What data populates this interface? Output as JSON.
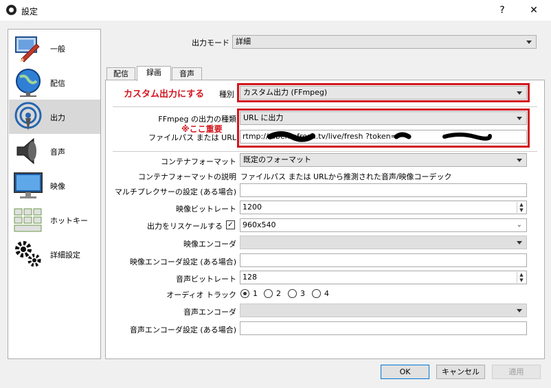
{
  "window": {
    "title": "設定",
    "help_glyph": "?",
    "close_glyph": "✕"
  },
  "sidebar": {
    "items": [
      {
        "label": "一般",
        "icon": "general-icon"
      },
      {
        "label": "配信",
        "icon": "stream-icon"
      },
      {
        "label": "出力",
        "icon": "output-icon",
        "active": true
      },
      {
        "label": "音声",
        "icon": "audio-icon"
      },
      {
        "label": "映像",
        "icon": "video-icon"
      },
      {
        "label": "ホットキー",
        "icon": "hotkeys-icon"
      },
      {
        "label": "詳細設定",
        "icon": "advanced-icon"
      }
    ]
  },
  "output": {
    "mode_label": "出力モード",
    "mode_value": "詳細",
    "tabs": [
      {
        "label": "配信"
      },
      {
        "label": "録画",
        "active": true
      },
      {
        "label": "音声"
      }
    ],
    "type_annotation": "カスタム出力にする",
    "type_label": "種別",
    "type_value": "カスタム出力 (FFmpeg)",
    "ffmpeg_type_label": "FFmpeg の出力の種類",
    "ffmpeg_type_value": "URL に出力",
    "important_annotation": "※ここ重要",
    "path_label": "ファイルパス または URL",
    "path_value": "rtmp://                   abemafresh.tv/live/fresh       ?token=",
    "container_label": "コンテナフォーマット",
    "container_value": "既定のフォーマット",
    "container_desc_label": "コンテナフォーマットの説明",
    "container_desc_value": "ファイルパス または URLから推測された音声/映像コーデック",
    "muxer_label": "マルチプレクサーの設定 (ある場合)",
    "muxer_value": "",
    "video_bitrate_label": "映像ビットレート",
    "video_bitrate_value": "1200",
    "rescale_label": "出力をリスケールする",
    "rescale_checked": "✓",
    "rescale_value": "960x540",
    "video_encoder_label": "映像エンコーダ",
    "video_encoder_value": "",
    "video_encoder_settings_label": "映像エンコーダ設定 (ある場合)",
    "video_encoder_settings_value": "",
    "audio_bitrate_label": "音声ビットレート",
    "audio_bitrate_value": "128",
    "audio_track_label": "オーディオ トラック",
    "audio_tracks": [
      "1",
      "2",
      "3",
      "4"
    ],
    "audio_encoder_label": "音声エンコーダ",
    "audio_encoder_value": "",
    "audio_encoder_settings_label": "音声エンコーダ設定 (ある場合)",
    "audio_encoder_settings_value": ""
  },
  "buttons": {
    "ok": "OK",
    "cancel": "キャンセル",
    "apply": "適用"
  },
  "colors": {
    "highlight": "#d2151d",
    "accent": "#0078d7"
  }
}
